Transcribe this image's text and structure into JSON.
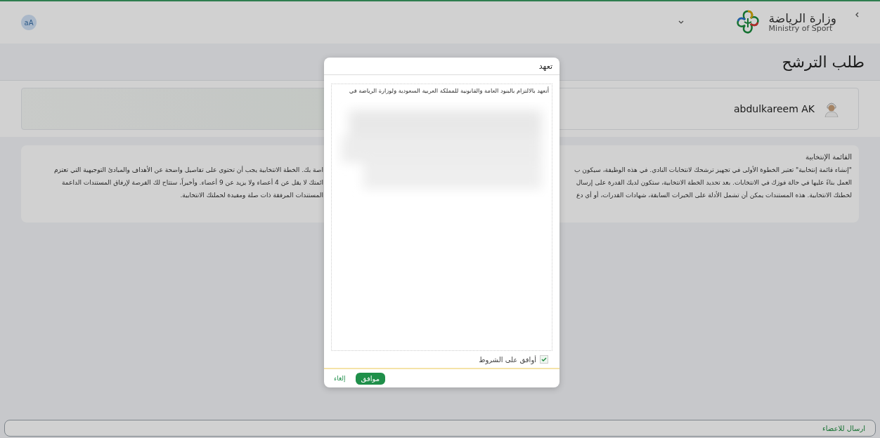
{
  "header": {
    "brand_ar": "وزارة الرياضة",
    "brand_en": "Ministry of Sport",
    "avatar": "aA"
  },
  "page_title": "طلب الترشح",
  "user": {
    "name": "abdulkareem AK"
  },
  "info": {
    "title": "القائمة الإنتخابية",
    "lines_right": [
      "\"إنشاء قائمة إنتخابية\" تعتبر الخطوة الأولى في تجهيز ترشحك لانتخابات النادي. في هذه الوظيفة، سيكون ب",
      "العمل بناءً عليها في حالة فوزك في الانتخابات. بعد تحديد الخطة الانتخابية، ستكون لديك القدرة على إرسال",
      "لخطتك الانتخابية. هذه المستندات يمكن أن تشمل الأدلة على الخبرات السابقة، شهادات القدرات، أو أي دع"
    ],
    "lines_left": [
      "اصة بك. الخطة الانتخابية يجب أن تحتوي على تفاصيل واضحة عن الأهداف والمبادئ التوجيهية التي تعتزم",
      "ائمتك لا يقل عن 4 أعضاء ولا يزيد عن 9 أعضاء. وأخيراً، ستتاح لك الفرصة لإرفاق المستندات الداعمة",
      "المستندات المرفقة ذات صلة ومفيدة لحملتك الانتخابية."
    ]
  },
  "dialog": {
    "title": "تعهد",
    "text": "أتعهد بالالتزام بالبنود العامة والقانونية للمملكة العربية السعودية ولوزارة الرياضة في",
    "agree": {
      "label": "أوافق على الشروط",
      "checked": true
    },
    "buttons": [
      {
        "label": "موافق",
        "kind": "primary"
      },
      {
        "label": "إلغاء",
        "kind": "link"
      }
    ]
  },
  "footer_button": "ارسال للاعضاء"
}
